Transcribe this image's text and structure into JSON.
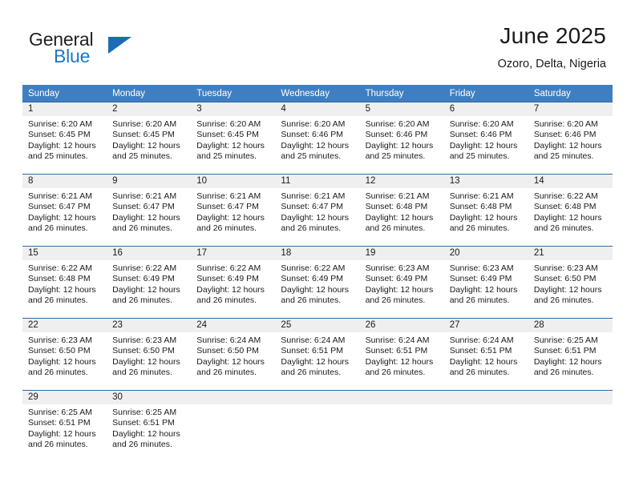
{
  "brand": {
    "name_part1": "General",
    "name_part2": "Blue",
    "accent_color": "#1b6cb5"
  },
  "header": {
    "title": "June 2025",
    "location": "Ozoro, Delta, Nigeria"
  },
  "calendar": {
    "header_bg": "#3f7fc1",
    "daynum_bg": "#efefef",
    "row_border_color": "#2d6ca8",
    "weekday_headers": [
      "Sunday",
      "Monday",
      "Tuesday",
      "Wednesday",
      "Thursday",
      "Friday",
      "Saturday"
    ],
    "weeks": [
      [
        {
          "day": "1",
          "sunrise": "Sunrise: 6:20 AM",
          "sunset": "Sunset: 6:45 PM",
          "daylight_line1": "Daylight: 12 hours",
          "daylight_line2": "and 25 minutes."
        },
        {
          "day": "2",
          "sunrise": "Sunrise: 6:20 AM",
          "sunset": "Sunset: 6:45 PM",
          "daylight_line1": "Daylight: 12 hours",
          "daylight_line2": "and 25 minutes."
        },
        {
          "day": "3",
          "sunrise": "Sunrise: 6:20 AM",
          "sunset": "Sunset: 6:45 PM",
          "daylight_line1": "Daylight: 12 hours",
          "daylight_line2": "and 25 minutes."
        },
        {
          "day": "4",
          "sunrise": "Sunrise: 6:20 AM",
          "sunset": "Sunset: 6:46 PM",
          "daylight_line1": "Daylight: 12 hours",
          "daylight_line2": "and 25 minutes."
        },
        {
          "day": "5",
          "sunrise": "Sunrise: 6:20 AM",
          "sunset": "Sunset: 6:46 PM",
          "daylight_line1": "Daylight: 12 hours",
          "daylight_line2": "and 25 minutes."
        },
        {
          "day": "6",
          "sunrise": "Sunrise: 6:20 AM",
          "sunset": "Sunset: 6:46 PM",
          "daylight_line1": "Daylight: 12 hours",
          "daylight_line2": "and 25 minutes."
        },
        {
          "day": "7",
          "sunrise": "Sunrise: 6:20 AM",
          "sunset": "Sunset: 6:46 PM",
          "daylight_line1": "Daylight: 12 hours",
          "daylight_line2": "and 25 minutes."
        }
      ],
      [
        {
          "day": "8",
          "sunrise": "Sunrise: 6:21 AM",
          "sunset": "Sunset: 6:47 PM",
          "daylight_line1": "Daylight: 12 hours",
          "daylight_line2": "and 26 minutes."
        },
        {
          "day": "9",
          "sunrise": "Sunrise: 6:21 AM",
          "sunset": "Sunset: 6:47 PM",
          "daylight_line1": "Daylight: 12 hours",
          "daylight_line2": "and 26 minutes."
        },
        {
          "day": "10",
          "sunrise": "Sunrise: 6:21 AM",
          "sunset": "Sunset: 6:47 PM",
          "daylight_line1": "Daylight: 12 hours",
          "daylight_line2": "and 26 minutes."
        },
        {
          "day": "11",
          "sunrise": "Sunrise: 6:21 AM",
          "sunset": "Sunset: 6:47 PM",
          "daylight_line1": "Daylight: 12 hours",
          "daylight_line2": "and 26 minutes."
        },
        {
          "day": "12",
          "sunrise": "Sunrise: 6:21 AM",
          "sunset": "Sunset: 6:48 PM",
          "daylight_line1": "Daylight: 12 hours",
          "daylight_line2": "and 26 minutes."
        },
        {
          "day": "13",
          "sunrise": "Sunrise: 6:21 AM",
          "sunset": "Sunset: 6:48 PM",
          "daylight_line1": "Daylight: 12 hours",
          "daylight_line2": "and 26 minutes."
        },
        {
          "day": "14",
          "sunrise": "Sunrise: 6:22 AM",
          "sunset": "Sunset: 6:48 PM",
          "daylight_line1": "Daylight: 12 hours",
          "daylight_line2": "and 26 minutes."
        }
      ],
      [
        {
          "day": "15",
          "sunrise": "Sunrise: 6:22 AM",
          "sunset": "Sunset: 6:48 PM",
          "daylight_line1": "Daylight: 12 hours",
          "daylight_line2": "and 26 minutes."
        },
        {
          "day": "16",
          "sunrise": "Sunrise: 6:22 AM",
          "sunset": "Sunset: 6:49 PM",
          "daylight_line1": "Daylight: 12 hours",
          "daylight_line2": "and 26 minutes."
        },
        {
          "day": "17",
          "sunrise": "Sunrise: 6:22 AM",
          "sunset": "Sunset: 6:49 PM",
          "daylight_line1": "Daylight: 12 hours",
          "daylight_line2": "and 26 minutes."
        },
        {
          "day": "18",
          "sunrise": "Sunrise: 6:22 AM",
          "sunset": "Sunset: 6:49 PM",
          "daylight_line1": "Daylight: 12 hours",
          "daylight_line2": "and 26 minutes."
        },
        {
          "day": "19",
          "sunrise": "Sunrise: 6:23 AM",
          "sunset": "Sunset: 6:49 PM",
          "daylight_line1": "Daylight: 12 hours",
          "daylight_line2": "and 26 minutes."
        },
        {
          "day": "20",
          "sunrise": "Sunrise: 6:23 AM",
          "sunset": "Sunset: 6:49 PM",
          "daylight_line1": "Daylight: 12 hours",
          "daylight_line2": "and 26 minutes."
        },
        {
          "day": "21",
          "sunrise": "Sunrise: 6:23 AM",
          "sunset": "Sunset: 6:50 PM",
          "daylight_line1": "Daylight: 12 hours",
          "daylight_line2": "and 26 minutes."
        }
      ],
      [
        {
          "day": "22",
          "sunrise": "Sunrise: 6:23 AM",
          "sunset": "Sunset: 6:50 PM",
          "daylight_line1": "Daylight: 12 hours",
          "daylight_line2": "and 26 minutes."
        },
        {
          "day": "23",
          "sunrise": "Sunrise: 6:23 AM",
          "sunset": "Sunset: 6:50 PM",
          "daylight_line1": "Daylight: 12 hours",
          "daylight_line2": "and 26 minutes."
        },
        {
          "day": "24",
          "sunrise": "Sunrise: 6:24 AM",
          "sunset": "Sunset: 6:50 PM",
          "daylight_line1": "Daylight: 12 hours",
          "daylight_line2": "and 26 minutes."
        },
        {
          "day": "25",
          "sunrise": "Sunrise: 6:24 AM",
          "sunset": "Sunset: 6:51 PM",
          "daylight_line1": "Daylight: 12 hours",
          "daylight_line2": "and 26 minutes."
        },
        {
          "day": "26",
          "sunrise": "Sunrise: 6:24 AM",
          "sunset": "Sunset: 6:51 PM",
          "daylight_line1": "Daylight: 12 hours",
          "daylight_line2": "and 26 minutes."
        },
        {
          "day": "27",
          "sunrise": "Sunrise: 6:24 AM",
          "sunset": "Sunset: 6:51 PM",
          "daylight_line1": "Daylight: 12 hours",
          "daylight_line2": "and 26 minutes."
        },
        {
          "day": "28",
          "sunrise": "Sunrise: 6:25 AM",
          "sunset": "Sunset: 6:51 PM",
          "daylight_line1": "Daylight: 12 hours",
          "daylight_line2": "and 26 minutes."
        }
      ],
      [
        {
          "day": "29",
          "sunrise": "Sunrise: 6:25 AM",
          "sunset": "Sunset: 6:51 PM",
          "daylight_line1": "Daylight: 12 hours",
          "daylight_line2": "and 26 minutes."
        },
        {
          "day": "30",
          "sunrise": "Sunrise: 6:25 AM",
          "sunset": "Sunset: 6:51 PM",
          "daylight_line1": "Daylight: 12 hours",
          "daylight_line2": "and 26 minutes."
        },
        {
          "day": "",
          "sunrise": "",
          "sunset": "",
          "daylight_line1": "",
          "daylight_line2": ""
        },
        {
          "day": "",
          "sunrise": "",
          "sunset": "",
          "daylight_line1": "",
          "daylight_line2": ""
        },
        {
          "day": "",
          "sunrise": "",
          "sunset": "",
          "daylight_line1": "",
          "daylight_line2": ""
        },
        {
          "day": "",
          "sunrise": "",
          "sunset": "",
          "daylight_line1": "",
          "daylight_line2": ""
        },
        {
          "day": "",
          "sunrise": "",
          "sunset": "",
          "daylight_line1": "",
          "daylight_line2": ""
        }
      ]
    ]
  }
}
